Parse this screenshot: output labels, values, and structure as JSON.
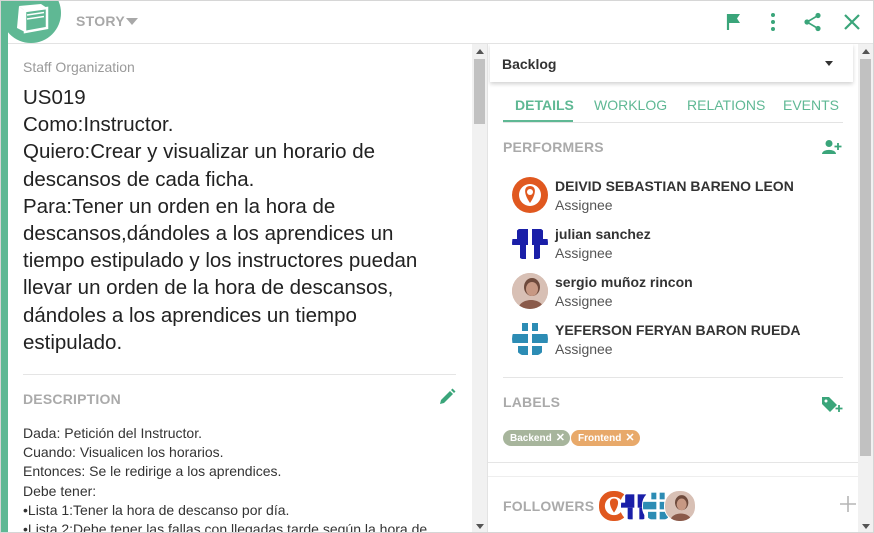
{
  "header": {
    "item_type": "STORY",
    "icons": [
      "book-icon",
      "chevron-down-icon",
      "flag-icon",
      "more-vertical-icon",
      "share-icon",
      "close-icon"
    ],
    "accent_color": "#5fb894"
  },
  "left": {
    "project": "Staff Organization",
    "story": "US019\nComo:Instructor.\nQuiero:Crear y visualizar un horario de descansos de cada ficha.\nPara:Tener un orden en la hora de descansos,dándoles a los aprendices un tiempo estipulado y los instructores puedan llevar un orden de la hora de descansos, dándoles a los aprendices un tiempo estipulado.",
    "description_title": "DESCRIPTION",
    "description": "Dada: Petición del Instructor.\nCuando: Visualicen los horarios.\nEntonces: Se le redirige a los aprendices.\nDebe tener:\n•Lista 1:Tener  la hora de descanso por día.\n•Lista 2:Debe tener las fallas con llegadas tarde según la hora de"
  },
  "right": {
    "status": "Backlog",
    "tabs": [
      {
        "label": "DETAILS",
        "active": true
      },
      {
        "label": "WORKLOG",
        "active": false
      },
      {
        "label": "RELATIONS",
        "active": false
      },
      {
        "label": "EVENTS",
        "active": false
      }
    ],
    "performers_title": "PERFORMERS",
    "performers": [
      {
        "name": "DEIVID SEBASTIAN BARENO LEON",
        "role": "Assignee"
      },
      {
        "name": "julian sanchez",
        "role": "Assignee"
      },
      {
        "name": "sergio muñoz rincon",
        "role": "Assignee"
      },
      {
        "name": "YEFERSON FERYAN BARON RUEDA",
        "role": "Assignee"
      }
    ],
    "labels_title": "LABELS",
    "labels": [
      {
        "text": "Backend",
        "color": "#a7b59c"
      },
      {
        "text": "Frontend",
        "color": "#e8a96a"
      }
    ],
    "followers_title": "FOLLOWERS"
  }
}
